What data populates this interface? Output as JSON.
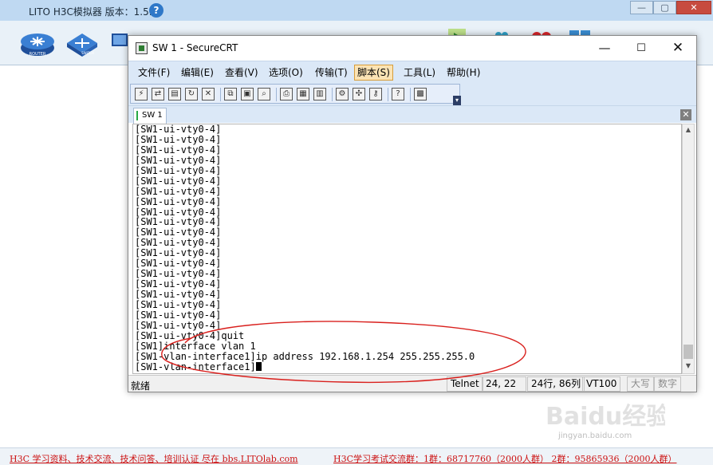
{
  "outer": {
    "title": "LITO H3C模拟器 版本：1.5.2",
    "help_icon": "?",
    "controls": {
      "min": "—",
      "max": "▢",
      "close": "✕"
    },
    "toolbar_icons": [
      "router-icon",
      "switch-icon",
      "pc-icon",
      "play-icon",
      "people-icon",
      "heart-icon",
      "grid-icon"
    ],
    "router_label": "ROUTER",
    "switch_label": "SWITCH",
    "footer_left": "H3C 学习资料、技术交流、技术问答、培训认证 尽在 bbs.LITOlab.com",
    "footer_right": "H3C学习考试交流群：1群：68717760（2000人群） 2群：95865936（2000人群）",
    "watermark_text": "Baidu经验",
    "watermark_url": "jingyan.baidu.com"
  },
  "crt": {
    "title": "SW 1 - SecureCRT",
    "controls": {
      "min": "—",
      "max": "☐",
      "close": "✕"
    },
    "menu": [
      "文件(F)",
      "编辑(E)",
      "查看(V)",
      "选项(O)",
      "传输(T)",
      "脚本(S)",
      "工具(L)",
      "帮助(H)"
    ],
    "active_menu": "脚本(S)",
    "toolbar_icons": [
      "connect-icon",
      "quick-connect-icon",
      "connect-in-tab-icon",
      "reconnect-icon",
      "disconnect-icon",
      "copy-icon",
      "paste-icon",
      "find-icon",
      "print-icon",
      "print-selection-icon",
      "printer-setup-icon",
      "session-options-icon",
      "global-options-icon",
      "keymap-icon",
      "help-icon",
      "sftp-icon"
    ],
    "tab_label": "SW 1",
    "tab_close": "✕",
    "terminal": {
      "lines": [
        "[SW1-ui-vty0-4]",
        "[SW1-ui-vty0-4]",
        "[SW1-ui-vty0-4]",
        "[SW1-ui-vty0-4]",
        "[SW1-ui-vty0-4]",
        "[SW1-ui-vty0-4]",
        "[SW1-ui-vty0-4]",
        "[SW1-ui-vty0-4]",
        "[SW1-ui-vty0-4]",
        "[SW1-ui-vty0-4]",
        "[SW1-ui-vty0-4]",
        "[SW1-ui-vty0-4]",
        "[SW1-ui-vty0-4]",
        "[SW1-ui-vty0-4]",
        "[SW1-ui-vty0-4]",
        "[SW1-ui-vty0-4]",
        "[SW1-ui-vty0-4]",
        "[SW1-ui-vty0-4]",
        "[SW1-ui-vty0-4]",
        "[SW1-ui-vty0-4]",
        "[SW1-ui-vty0-4]quit",
        "[SW1]interface vlan 1",
        "[SW1-vlan-interface1]ip address 192.168.1.254 255.255.255.0",
        "[SW1-vlan-interface1]"
      ]
    },
    "status": {
      "ready": "就绪",
      "protocol": "Telnet",
      "cursor_pos": "24,  22",
      "size": "24行, 86列",
      "emulation": "VT100",
      "caps": "大写",
      "num": "数字"
    }
  },
  "colors": {
    "annotation": "#d9201d",
    "footer_text": "#cc1111",
    "menu_active_bg": "#fbe3b4",
    "menubar_bg": "#dbe8f7"
  }
}
